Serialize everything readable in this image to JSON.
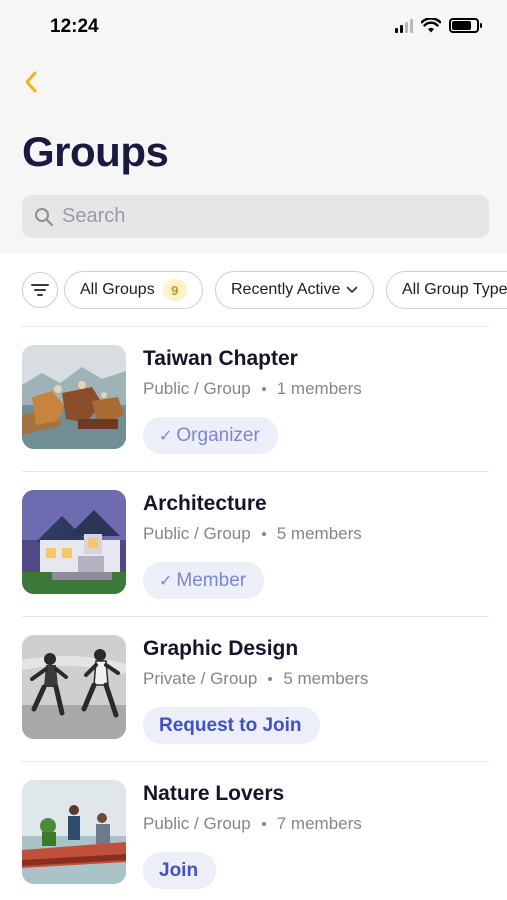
{
  "status_bar": {
    "time": "12:24"
  },
  "header": {
    "title": "Groups"
  },
  "search": {
    "placeholder": "Search"
  },
  "filters": {
    "chips": [
      {
        "label": "All Groups",
        "badge": "9"
      },
      {
        "label": "Recently Active"
      },
      {
        "label": "All Group Types"
      }
    ]
  },
  "groups": [
    {
      "name": "Taiwan Chapter",
      "visibility": "Public / Group",
      "members": "1 members",
      "action": "Organizer",
      "action_kind": "status"
    },
    {
      "name": "Architecture",
      "visibility": "Public / Group",
      "members": "5 members",
      "action": "Member",
      "action_kind": "status"
    },
    {
      "name": "Graphic Design",
      "visibility": "Private / Group",
      "members": "5 members",
      "action": "Request to Join",
      "action_kind": "cta"
    },
    {
      "name": "Nature Lovers",
      "visibility": "Public / Group",
      "members": "7 members",
      "action": "Join",
      "action_kind": "cta"
    }
  ],
  "colors": {
    "accent": "#4451c6",
    "back_arrow": "#f0b21a",
    "badge_bg": "#fdf2cc",
    "badge_text": "#c69a11"
  }
}
